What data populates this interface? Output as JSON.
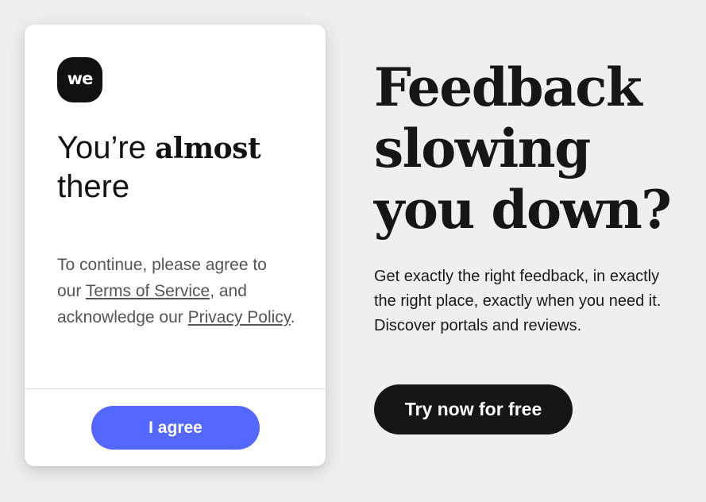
{
  "dialog": {
    "logo_text": "we",
    "title_prefix": "You’re ",
    "title_bold": "almost",
    "title_suffix": "there",
    "body_before": "To continue, please agree to our ",
    "terms_link": "Terms of Service",
    "body_middle": ", and acknowledge our ",
    "privacy_link": "Privacy Policy",
    "body_after": ".",
    "agree_button": "I agree",
    "agree_color": "#5468ff"
  },
  "promo": {
    "headline": "Feedback slowing you down?",
    "description": "Get exactly the right feedback, in exactly the right place, exactly when you need it. Discover portals and reviews.",
    "cta_button": "Try now for free"
  },
  "colors": {
    "background": "#efefef",
    "card": "#ffffff",
    "dark": "#161616"
  }
}
